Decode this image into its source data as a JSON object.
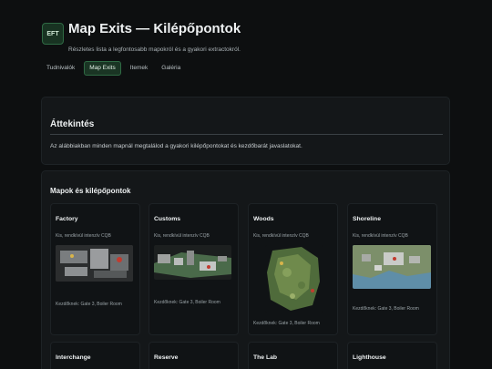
{
  "header": {
    "logo_text": "EFT",
    "title": "Map Exits — Kilépőpontok",
    "subtitle": "Részletes lista a legfontosabb mapokról és a gyakori extractokról."
  },
  "tabs": [
    {
      "label": "Tudnivalók",
      "active": false
    },
    {
      "label": "Map Exits",
      "active": true
    },
    {
      "label": "Itemek",
      "active": false
    },
    {
      "label": "Galéria",
      "active": false
    }
  ],
  "overview": {
    "title": "Áttekintés",
    "text": "Az alábbiakban minden mapnál megtalálod a gyakori kilépőpontokat és kezdőbarát javaslatokat."
  },
  "maps_section": {
    "title": "Mapok és kilépőpontok",
    "cards": [
      {
        "name": "Factory",
        "desc": "Kis, rendkívül intenzív CQB",
        "tip": "Kezdőknek: Gate 3, Boiler Room"
      },
      {
        "name": "Customs",
        "desc": "Kis, rendkívül intenzív CQB",
        "tip": "Kezdőknek: Gate 3, Boiler Room"
      },
      {
        "name": "Woods",
        "desc": "Kis, rendkívül intenzív CQB",
        "tip": "Kezdőknek: Gate 3, Boiler Room"
      },
      {
        "name": "Shoreline",
        "desc": "Kis, rendkívül intenzív CQB",
        "tip": "Kezdőknek: Gate 3, Boiler Room"
      },
      {
        "name": "Interchange"
      },
      {
        "name": "Reserve"
      },
      {
        "name": "The Lab"
      },
      {
        "name": "Lighthouse"
      }
    ]
  },
  "colors": {
    "background": "#0d0f10",
    "panel": "#141719",
    "accent_green": "#2f6a44"
  }
}
